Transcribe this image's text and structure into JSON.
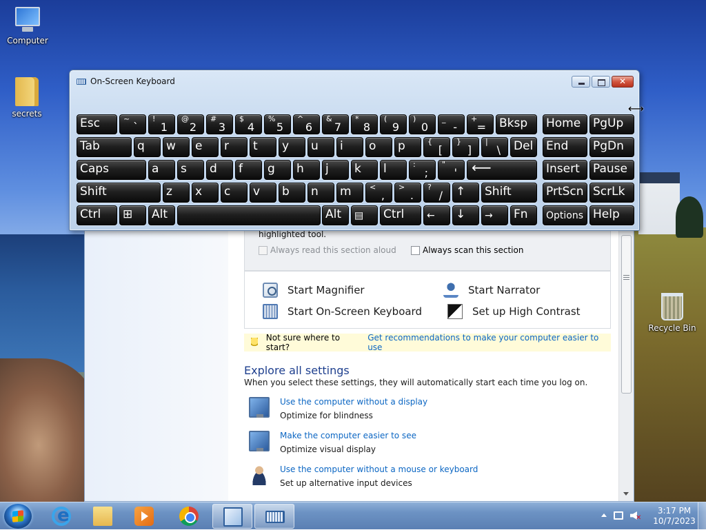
{
  "desktop": {
    "icons": [
      {
        "label": "Computer",
        "icon": "computer-icon"
      },
      {
        "label": "secrets",
        "icon": "folder-icon"
      },
      {
        "label": "Recycle Bin",
        "icon": "recycle-bin-icon"
      }
    ]
  },
  "ease_of_access": {
    "scan_text": "highlighted tool.",
    "checkbox_read_aloud": "Always read this section aloud",
    "checkbox_scan": "Always scan this section",
    "tools": [
      {
        "label": "Start Magnifier",
        "icon": "magnifier-icon"
      },
      {
        "label": "Start Narrator",
        "icon": "narrator-icon"
      },
      {
        "label": "Start On-Screen Keyboard",
        "icon": "keyboard-icon"
      },
      {
        "label": "Set up High Contrast",
        "icon": "high-contrast-icon"
      }
    ],
    "tip_text": "Not sure where to start?",
    "tip_link": "Get recommendations to make your computer easier to use",
    "section_title": "Explore all settings",
    "section_subtitle": "When you select these settings, they will automatically start each time you log on.",
    "settings": [
      {
        "link": "Use the computer without a display",
        "desc": "Optimize for blindness"
      },
      {
        "link": "Make the computer easier to see",
        "desc": "Optimize visual display"
      },
      {
        "link": "Use the computer without a mouse or keyboard",
        "desc": "Set up alternative input devices"
      }
    ]
  },
  "osk": {
    "title": "On-Screen Keyboard",
    "keys": {
      "esc": "Esc",
      "bksp": "Bksp",
      "home": "Home",
      "pgup": "PgUp",
      "tab": "Tab",
      "del": "Del",
      "end": "End",
      "pgdn": "PgDn",
      "caps": "Caps",
      "insert": "Insert",
      "pause": "Pause",
      "shift": "Shift",
      "prtscn": "PrtScn",
      "scrlk": "ScrLk",
      "ctrl": "Ctrl",
      "alt": "Alt",
      "fn": "Fn",
      "options": "Options",
      "help": "Help",
      "tilde_shift": "~",
      "tilde_base": "`",
      "n1s": "!",
      "n1": "1",
      "n2s": "@",
      "n2": "2",
      "n3s": "#",
      "n3": "3",
      "n4s": "$",
      "n4": "4",
      "n5s": "%",
      "n5": "5",
      "n6s": "^",
      "n6": "6",
      "n7s": "&",
      "n7": "7",
      "n8s": "*",
      "n8": "8",
      "n9s": "(",
      "n9": "9",
      "n0s": ")",
      "n0": "0",
      "minus_s": "_",
      "minus": "-",
      "eq_s": "+",
      "eq": "=",
      "q": "q",
      "w": "w",
      "e": "e",
      "r": "r",
      "t": "t",
      "y": "y",
      "u": "u",
      "i": "i",
      "o": "o",
      "p": "p",
      "lbr_s": "{",
      "lbr": "[",
      "rbr_s": "}",
      "rbr": "]",
      "bsl_s": "|",
      "bsl": "\\",
      "a": "a",
      "s": "s",
      "d": "d",
      "f": "f",
      "g": "g",
      "h": "h",
      "j": "j",
      "k": "k",
      "l": "l",
      "semi_s": ":",
      "semi": ";",
      "quote_s": "\"",
      "quote": "'",
      "enter": "⟵",
      "z": "z",
      "x": "x",
      "c": "c",
      "v": "v",
      "b": "b",
      "n": "n",
      "m": "m",
      "comma_s": "<",
      "comma": ",",
      "dot_s": ">",
      "dot": ".",
      "slash_s": "?",
      "slash": "/",
      "up": "↑",
      "left": "←",
      "down": "↓",
      "right": "→",
      "win": "⊞",
      "menu": "▤"
    }
  },
  "taskbar": {
    "clock_time": "3:17 PM",
    "clock_date": "10/7/2023",
    "apps": [
      {
        "name": "Internet Explorer",
        "icon": "internet-explorer-icon"
      },
      {
        "name": "Windows Explorer",
        "icon": "file-explorer-icon"
      },
      {
        "name": "Windows Media Player",
        "icon": "media-player-icon"
      },
      {
        "name": "Google Chrome",
        "icon": "chrome-icon"
      },
      {
        "name": "Control Panel",
        "icon": "control-panel-icon"
      },
      {
        "name": "On-Screen Keyboard",
        "icon": "on-screen-keyboard-icon"
      }
    ]
  }
}
